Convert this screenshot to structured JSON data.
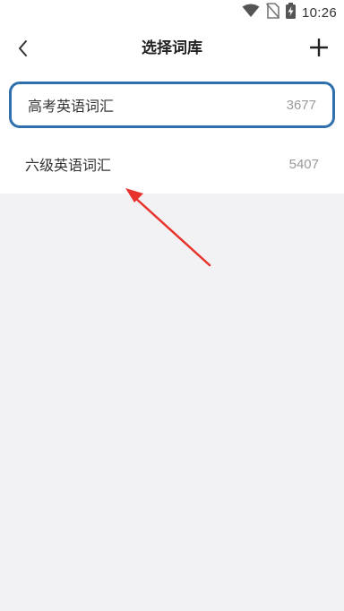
{
  "status_bar": {
    "time": "10:26",
    "icons": [
      "wifi-icon",
      "no-sim-icon",
      "battery-charging-icon"
    ]
  },
  "header": {
    "back_icon": "chevron-left-icon",
    "title": "选择词库",
    "add_icon": "plus-icon"
  },
  "word_banks": [
    {
      "name": "高考英语词汇",
      "count": "3677",
      "selected": true
    },
    {
      "name": "六级英语词汇",
      "count": "5407",
      "selected": false
    }
  ],
  "colors": {
    "accent": "#2f6fad",
    "annotation_arrow": "#e8322c",
    "background": "#f2f2f5"
  }
}
